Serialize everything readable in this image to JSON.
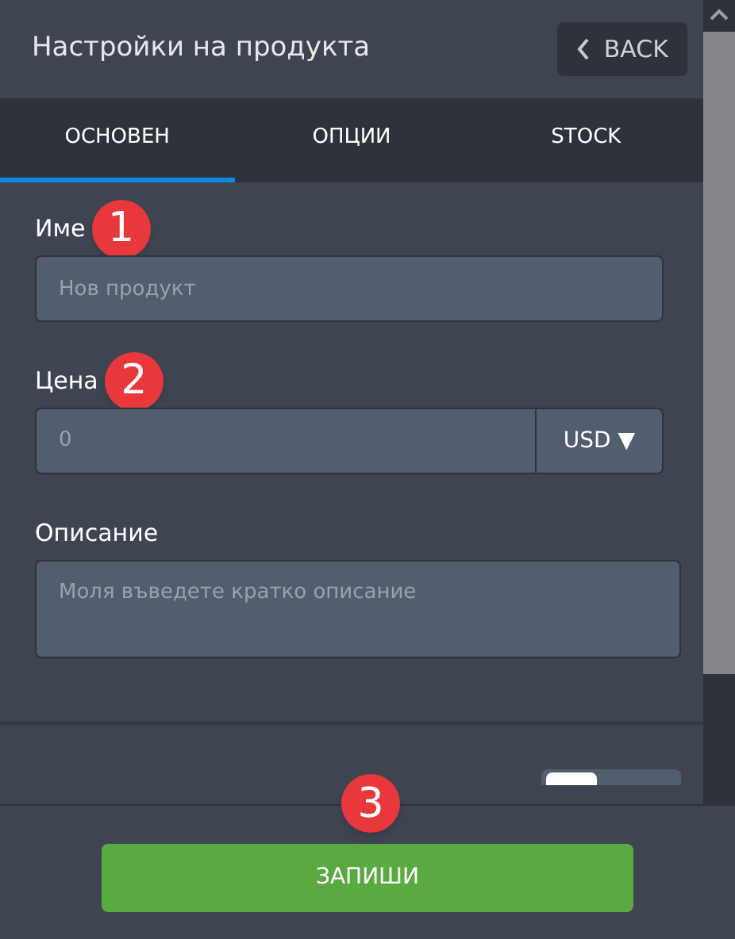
{
  "header": {
    "title": "Настройки на продукта",
    "back_button": "BACK"
  },
  "tabs": [
    {
      "label": "ОСНОВЕН",
      "selected": true
    },
    {
      "label": "ОПЦИИ",
      "selected": false
    },
    {
      "label": "STOCK",
      "selected": false
    }
  ],
  "fields": [
    {
      "kind": "text",
      "label": "Име",
      "placeholder": "Нов продукт",
      "marker": "1"
    },
    {
      "kind": "price",
      "label": "Цена",
      "placeholder": "0",
      "currency": "USD ▼",
      "marker": "2"
    },
    {
      "kind": "textarea",
      "label": "Описание",
      "placeholder": "Моля въведете кратко описание"
    }
  ],
  "toggle": {
    "on": false
  },
  "save_button": {
    "label": "ЗАПИШИ",
    "marker": "3"
  }
}
